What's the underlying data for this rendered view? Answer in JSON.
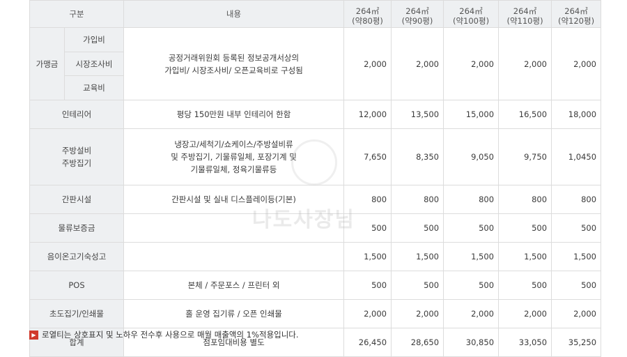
{
  "header": {
    "col_group": "구분",
    "col_desc": "내용",
    "sizes": [
      {
        "area": "264㎡",
        "pyeong": "(약80평)"
      },
      {
        "area": "264㎡",
        "pyeong": "(약90평)"
      },
      {
        "area": "264㎡",
        "pyeong": "(약100평)"
      },
      {
        "area": "264㎡",
        "pyeong": "(약110평)"
      },
      {
        "area": "264㎡",
        "pyeong": "(약120평)"
      }
    ]
  },
  "membership": {
    "label": "가맹금",
    "subs": [
      "가입비",
      "시장조사비",
      "교육비"
    ],
    "desc_line1": "공정거래위원회 등록된 정보공개서상의",
    "desc_line2": "가입비/ 시장조사비/ 오픈교육비로 구성됨",
    "values": [
      "2,000",
      "2,000",
      "2,000",
      "2,000",
      "2,000"
    ]
  },
  "rows": [
    {
      "label": "인테리어",
      "desc": "평당 150만원 내부 인테리어 한함",
      "values": [
        "12,000",
        "13,500",
        "15,000",
        "16,500",
        "18,000"
      ]
    },
    {
      "label": "주방설비\n주방집기",
      "desc": "냉장고/세척기/쇼케이스/주방설비류\n및 주방집기, 기물류일체, 포장기계 및\n기물류일체, 정육기물류등",
      "values": [
        "7,650",
        "8,350",
        "9,050",
        "9,750",
        "1,0450"
      ]
    },
    {
      "label": "간판시설",
      "desc": "간판시설 및 실내 디스플레이등(기본)",
      "values": [
        "800",
        "800",
        "800",
        "800",
        "800"
      ]
    },
    {
      "label": "물류보증금",
      "desc": "",
      "values": [
        "500",
        "500",
        "500",
        "500",
        "500"
      ]
    },
    {
      "label": "음이온고기숙성고",
      "desc": "",
      "values": [
        "1,500",
        "1,500",
        "1,500",
        "1,500",
        "1,500"
      ]
    },
    {
      "label": "POS",
      "desc": "본체 / 주문포스 / 프린터 외",
      "values": [
        "500",
        "500",
        "500",
        "500",
        "500"
      ]
    },
    {
      "label": "초도집기/인쇄물",
      "desc": "홀 운영 집기류 / 오픈 인쇄물",
      "values": [
        "2,000",
        "2,000",
        "2,000",
        "2,000",
        "2,000"
      ]
    },
    {
      "label": "합계",
      "desc": "점포임대비용 별도",
      "values": [
        "26,450",
        "28,650",
        "30,850",
        "33,050",
        "35,250"
      ]
    }
  ],
  "notes": [
    "로열티는 상호표지 및 노하우 전수후 사용으로 매월 매출액의 1%적용입니다."
  ],
  "watermark": "나도사장님",
  "colors": {
    "header_bg": "#eef0f2",
    "border": "#dcdcdc",
    "note_mark": "#d0392b"
  }
}
